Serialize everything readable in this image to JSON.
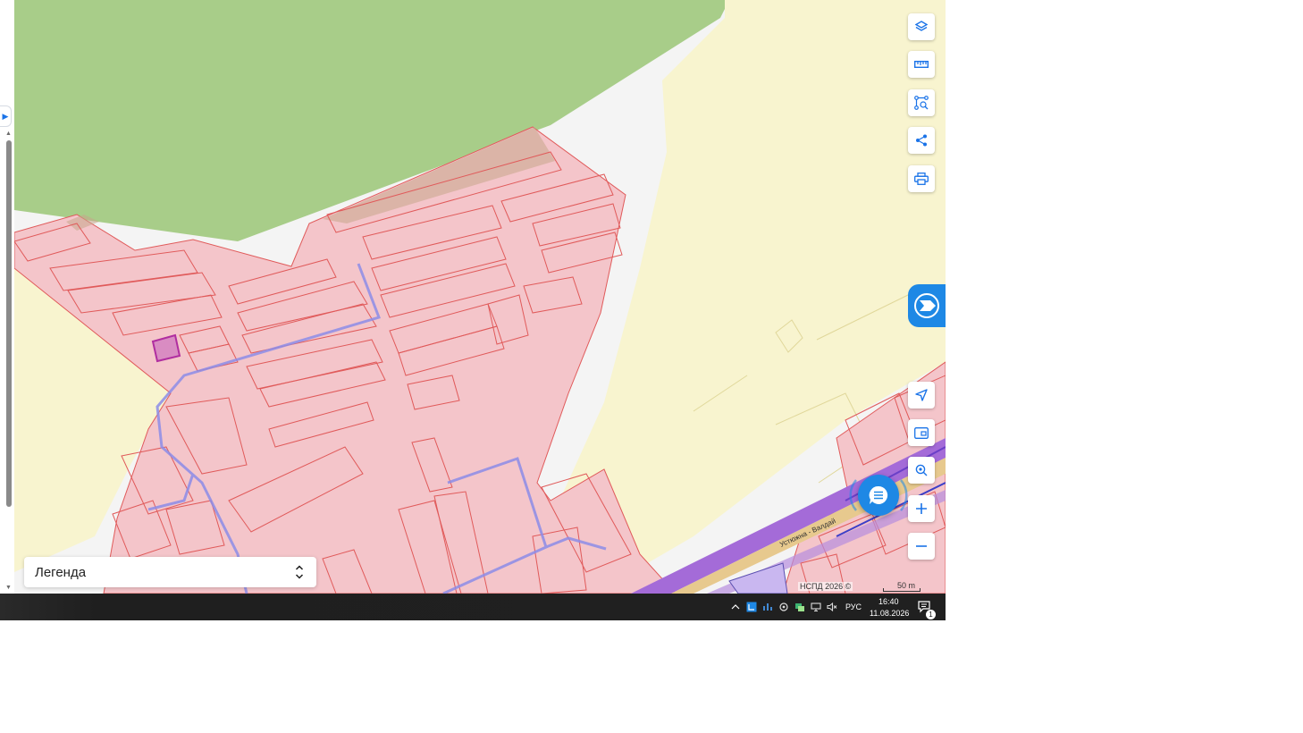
{
  "map": {
    "colors": {
      "forest": "#a8cd89",
      "agricultural": "#f8f4cf",
      "zone_fill": "#f4c5ca",
      "zone_stroke": "#e05a5a",
      "utility_line": "#8c8ce8",
      "road": "#a46bd8",
      "background": "#f4f4f4"
    },
    "road_label": "Устюжна - Валдай",
    "attribution": "НСПД 2026 ©",
    "scale_label": "50 m"
  },
  "toolbar": {
    "buttons": [
      {
        "name": "layers-button",
        "icon": "layers-icon"
      },
      {
        "name": "ruler-button",
        "icon": "ruler-icon"
      },
      {
        "name": "area-select-button",
        "icon": "area-select-icon"
      },
      {
        "name": "share-button",
        "icon": "share-icon"
      },
      {
        "name": "print-button",
        "icon": "printer-icon"
      }
    ],
    "nav_buttons": [
      {
        "name": "geolocation-button",
        "icon": "navigation-arrow-icon"
      },
      {
        "name": "minimap-button",
        "icon": "picture-in-picture-icon"
      },
      {
        "name": "location-search-button",
        "icon": "location-search-icon"
      },
      {
        "name": "zoom-in-button",
        "icon": "plus-icon"
      },
      {
        "name": "zoom-out-button",
        "icon": "minus-icon"
      }
    ]
  },
  "legend": {
    "label": "Легенда"
  },
  "taskbar": {
    "language": "РУС",
    "time": "16:40",
    "date": "11.08.2026",
    "notification_count": "1"
  }
}
